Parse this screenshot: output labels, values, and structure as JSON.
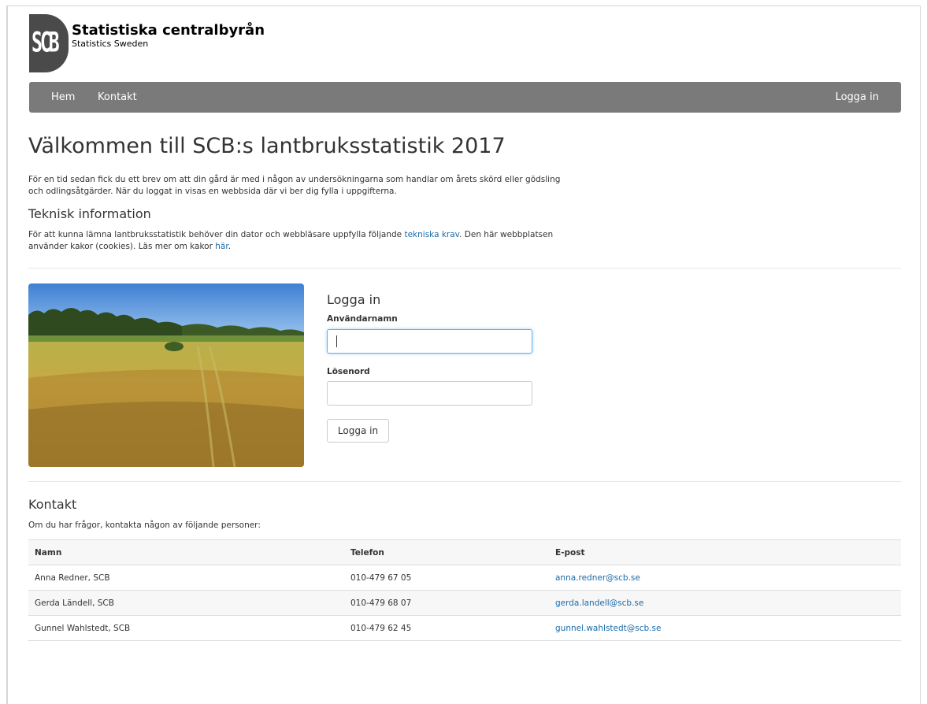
{
  "brand": {
    "logo_mark": "SCB",
    "title": "Statistiska centralbyrån",
    "subtitle": "Statistics Sweden"
  },
  "nav": {
    "items": [
      {
        "label": "Hem"
      },
      {
        "label": "Kontakt"
      }
    ],
    "login_label": "Logga in"
  },
  "main": {
    "heading": "Välkommen till SCB:s lantbruksstatistik 2017",
    "intro_line1": "För en tid sedan fick du ett brev om att din gård är med i någon av undersökningarna som handlar om årets skörd eller gödsling",
    "intro_line2": "och odlingsåtgärder. När du loggat in visas en webbsida där vi ber dig fylla i uppgifterna.",
    "tech_heading": "Teknisk information",
    "tech_text_a": "För att kunna lämna lantbruksstatistik behöver din dator och webbläsare uppfylla följande ",
    "tech_link": "tekniska krav",
    "tech_text_b": ". Den här webbplatsen",
    "tech_text_c": "använder kakor (cookies). Läs mer om kakor ",
    "cookies_link": "här",
    "tech_text_d": "."
  },
  "login": {
    "title": "Logga in",
    "username_label": "Användarnamn",
    "username_value": "",
    "password_label": "Lösenord",
    "password_value": "",
    "submit_label": "Logga in"
  },
  "contact": {
    "heading": "Kontakt",
    "intro": "Om du har frågor, kontakta någon av följande personer:",
    "columns": [
      "Namn",
      "Telefon",
      "E-post"
    ],
    "rows": [
      {
        "name": "Anna Redner, SCB",
        "phone": "010-479 67 05",
        "email": "anna.redner@scb.se"
      },
      {
        "name": "Gerda Ländell, SCB",
        "phone": "010-479 68 07",
        "email": "gerda.landell@scb.se"
      },
      {
        "name": "Gunnel Wahlstedt, SCB",
        "phone": "010-479 62 45",
        "email": "gunnel.wahlstedt@scb.se"
      }
    ]
  },
  "colors": {
    "navbar": "#7a7a7a",
    "link": "#1a6aa8",
    "focus_border": "#66afe9"
  }
}
